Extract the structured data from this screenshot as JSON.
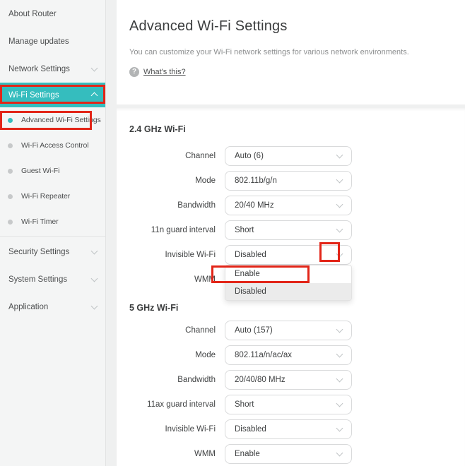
{
  "colors": {
    "accent_teal": "#35bdbe",
    "annotation_red": "#e22518",
    "sidebar_bg": "#f4f5f5",
    "card_bg": "#ffffff",
    "option_selected_bg": "#ebebeb"
  },
  "sidebar": {
    "items": [
      {
        "label": "About Router",
        "type": "top"
      },
      {
        "label": "Manage updates",
        "type": "top"
      },
      {
        "label": "Network Settings",
        "type": "group",
        "chevron": "down"
      },
      {
        "label": "Wi-Fi Settings",
        "type": "group",
        "chevron": "up",
        "active": true
      },
      {
        "label": "Advanced Wi-Fi Settings",
        "type": "sub",
        "active": true
      },
      {
        "label": "Wi-Fi Access Control",
        "type": "sub"
      },
      {
        "label": "Guest Wi-Fi",
        "type": "sub"
      },
      {
        "label": "Wi-Fi Repeater",
        "type": "sub"
      },
      {
        "label": "Wi-Fi Timer",
        "type": "sub"
      },
      {
        "label": "Security Settings",
        "type": "group",
        "chevron": "down",
        "divider_before": true
      },
      {
        "label": "System Settings",
        "type": "group",
        "chevron": "down"
      },
      {
        "label": "Application",
        "type": "group",
        "chevron": "down"
      }
    ]
  },
  "header": {
    "title": "Advanced Wi-Fi Settings",
    "description": "You can customize your Wi-Fi network settings for various network environments.",
    "help_link": "What's this?",
    "help_icon": "?"
  },
  "sections": [
    {
      "title": "2.4 GHz Wi-Fi",
      "rows": [
        {
          "label": "Channel",
          "value": "Auto (6)"
        },
        {
          "label": "Mode",
          "value": "802.11b/g/n"
        },
        {
          "label": "Bandwidth",
          "value": "20/40 MHz"
        },
        {
          "label": "11n guard interval",
          "value": "Short"
        },
        {
          "label": "Invisible Wi-Fi",
          "value": "Disabled",
          "open": true,
          "options": [
            "Enable",
            "Disabled"
          ],
          "selected_option": "Disabled"
        },
        {
          "label": "WMM",
          "value": ""
        }
      ]
    },
    {
      "title": "5 GHz Wi-Fi",
      "rows": [
        {
          "label": "Channel",
          "value": "Auto (157)"
        },
        {
          "label": "Mode",
          "value": "802.11a/n/ac/ax"
        },
        {
          "label": "Bandwidth",
          "value": "20/40/80 MHz"
        },
        {
          "label": "11ax guard interval",
          "value": "Short"
        },
        {
          "label": "Invisible Wi-Fi",
          "value": "Disabled"
        },
        {
          "label": "WMM",
          "value": "Enable"
        }
      ]
    }
  ]
}
